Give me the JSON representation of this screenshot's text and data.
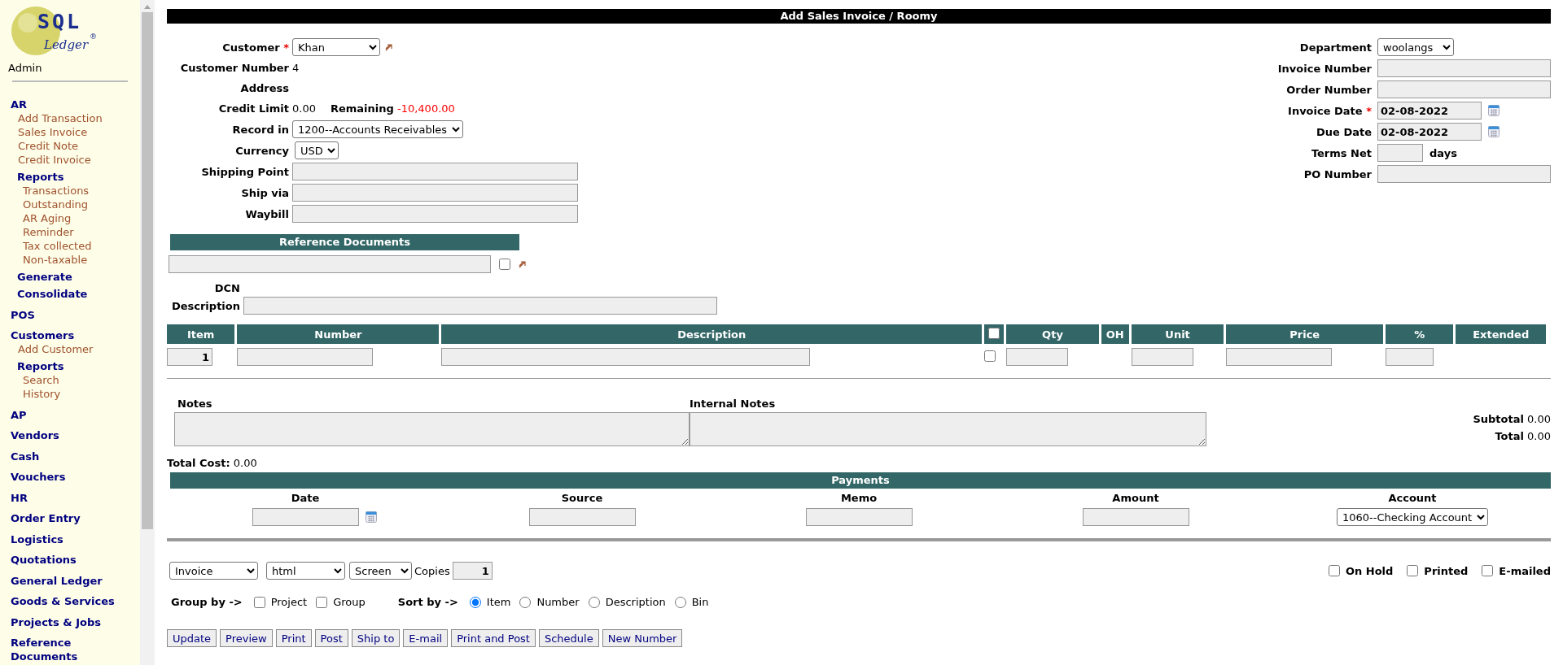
{
  "sidebar": {
    "logo": {
      "name": "SQL",
      "sub": "Ledger",
      "mark": "®"
    },
    "user": "Admin",
    "menu": [
      {
        "kind": "section",
        "label": "AR",
        "children": [
          {
            "kind": "link",
            "label": "Add Transaction"
          },
          {
            "kind": "link",
            "label": "Sales Invoice"
          },
          {
            "kind": "link",
            "label": "Credit Note"
          },
          {
            "kind": "link",
            "label": "Credit Invoice"
          },
          {
            "kind": "heading",
            "label": "Reports",
            "children": [
              {
                "kind": "link",
                "label": "Transactions"
              },
              {
                "kind": "link",
                "label": "Outstanding"
              },
              {
                "kind": "link",
                "label": "AR Aging"
              },
              {
                "kind": "link",
                "label": "Reminder"
              },
              {
                "kind": "link",
                "label": "Tax collected"
              },
              {
                "kind": "link",
                "label": "Non-taxable"
              }
            ]
          },
          {
            "kind": "heading",
            "label": "Generate"
          },
          {
            "kind": "heading",
            "label": "Consolidate"
          }
        ]
      },
      {
        "kind": "section",
        "label": "POS"
      },
      {
        "kind": "section",
        "label": "Customers",
        "children": [
          {
            "kind": "link",
            "label": "Add Customer"
          },
          {
            "kind": "heading",
            "label": "Reports",
            "children": [
              {
                "kind": "link",
                "label": "Search"
              },
              {
                "kind": "link",
                "label": "History"
              }
            ]
          }
        ]
      },
      {
        "kind": "section",
        "label": "AP"
      },
      {
        "kind": "section",
        "label": "Vendors"
      },
      {
        "kind": "section",
        "label": "Cash"
      },
      {
        "kind": "section",
        "label": "Vouchers"
      },
      {
        "kind": "section",
        "label": "HR"
      },
      {
        "kind": "section",
        "label": "Order Entry"
      },
      {
        "kind": "section",
        "label": "Logistics"
      },
      {
        "kind": "section",
        "label": "Quotations"
      },
      {
        "kind": "section",
        "label": "General Ledger"
      },
      {
        "kind": "section",
        "label": "Goods & Services"
      },
      {
        "kind": "section",
        "label": "Projects & Jobs"
      },
      {
        "kind": "section",
        "label": "Reference Documents"
      }
    ]
  },
  "title": "Add Sales Invoice / Roomy",
  "required_mark": "*",
  "customer": {
    "label": "Customer",
    "required": true,
    "value": "Khan"
  },
  "customer_number": {
    "label": "Customer Number",
    "value": "4"
  },
  "address": {
    "label": "Address"
  },
  "credit": {
    "label": "Credit Limit",
    "value": "0.00",
    "remaining_label": "Remaining",
    "remaining": "-10,400.00"
  },
  "record_in": {
    "label": "Record in",
    "value": "1200--Accounts Receivables"
  },
  "currency": {
    "label": "Currency",
    "value": "USD"
  },
  "shipping_fields": [
    {
      "label": "Shipping Point"
    },
    {
      "label": "Ship via"
    },
    {
      "label": "Waybill"
    }
  ],
  "right_fields": [
    {
      "kind": "select",
      "label": "Department",
      "required": false,
      "value": "woolangs"
    },
    {
      "kind": "text",
      "label": "Invoice Number",
      "required": false
    },
    {
      "kind": "text",
      "label": "Order Number",
      "required": false
    },
    {
      "kind": "date",
      "label": "Invoice Date",
      "required": true,
      "value": "02-08-2022"
    },
    {
      "kind": "date",
      "label": "Due Date",
      "required": false,
      "value": "02-08-2022"
    },
    {
      "kind": "terms",
      "label": "Terms Net",
      "required": false,
      "suffix": "days"
    },
    {
      "kind": "text",
      "label": "PO Number",
      "required": false
    }
  ],
  "reference": {
    "title": "Reference Documents",
    "checked": false,
    "dcn_label": "DCN",
    "description_label": "Description"
  },
  "items": {
    "columns": [
      {
        "kind": "text",
        "label": "Item"
      },
      {
        "kind": "text",
        "label": "Number"
      },
      {
        "kind": "text",
        "label": "Description"
      },
      {
        "kind": "checkbox",
        "checked": false
      },
      {
        "kind": "text",
        "label": "Qty"
      },
      {
        "kind": "text",
        "label": "OH"
      },
      {
        "kind": "text",
        "label": "Unit"
      },
      {
        "kind": "text",
        "label": "Price"
      },
      {
        "kind": "text",
        "label": "%"
      },
      {
        "kind": "text",
        "label": "Extended"
      }
    ],
    "row": {
      "item": "1",
      "checked": false
    }
  },
  "notes": {
    "label": "Notes",
    "internal_label": "Internal Notes"
  },
  "totals": [
    {
      "label": "Subtotal",
      "value": "0.00"
    },
    {
      "label": "Total",
      "value": "0.00"
    }
  ],
  "total_cost": {
    "label": "Total Cost:",
    "value": "0.00"
  },
  "payments": {
    "title": "Payments",
    "columns": [
      {
        "kind": "date",
        "label": "Date"
      },
      {
        "kind": "text",
        "label": "Source"
      },
      {
        "kind": "text",
        "label": "Memo"
      },
      {
        "kind": "text",
        "label": "Amount"
      },
      {
        "kind": "select",
        "label": "Account",
        "value": "1060--Checking Account"
      }
    ]
  },
  "print": {
    "selects": [
      "Invoice",
      "html",
      "Screen"
    ],
    "copies_label": "Copies",
    "copies": "1"
  },
  "flags": [
    {
      "label": "On Hold",
      "checked": false
    },
    {
      "label": "Printed",
      "checked": false
    },
    {
      "label": "E-mailed",
      "checked": false
    }
  ],
  "group_by": {
    "label": "Group by ->",
    "options": [
      {
        "label": "Project",
        "checked": false
      },
      {
        "label": "Group",
        "checked": false
      }
    ]
  },
  "sort_by": {
    "label": "Sort by ->",
    "options": [
      {
        "label": "Item",
        "selected": true
      },
      {
        "label": "Number",
        "selected": false
      },
      {
        "label": "Description",
        "selected": false
      },
      {
        "label": "Bin",
        "selected": false
      }
    ]
  },
  "buttons": [
    "Update",
    "Preview",
    "Print",
    "Post",
    "Ship to",
    "E-mail",
    "Print and Post",
    "Schedule",
    "New Number"
  ]
}
